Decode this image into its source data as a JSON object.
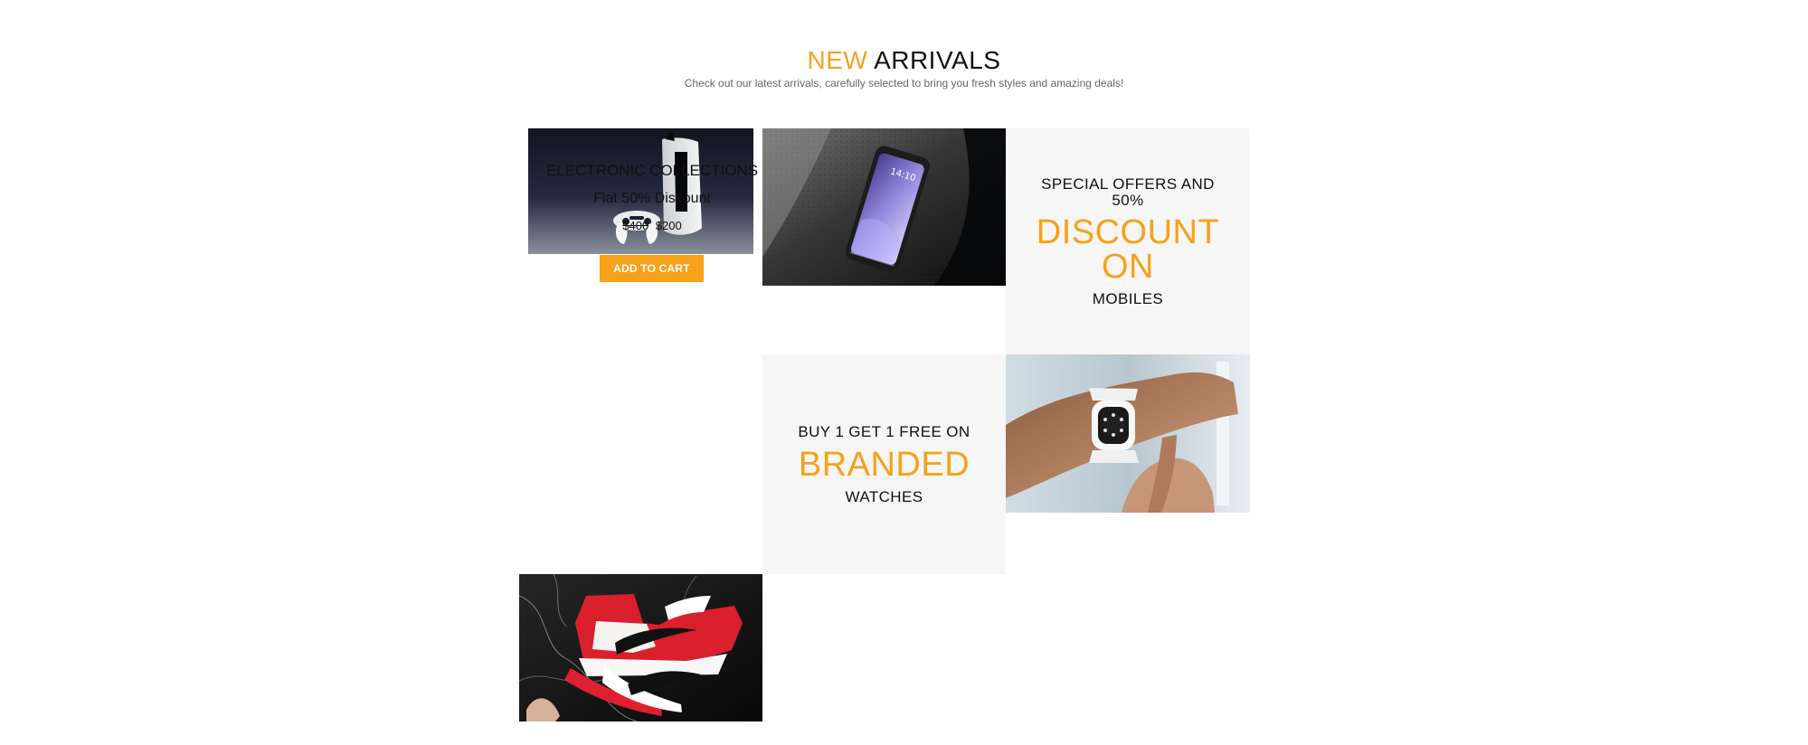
{
  "section": {
    "title_accent": "NEW",
    "title_rest": "ARRIVALS",
    "subtitle": "Check out our latest arrivals, carefully selected to bring you fresh styles and amazing deals!"
  },
  "electronic": {
    "heading": "ELECTRONIC COLLECTIONS",
    "discount": "Flat 50% Discount",
    "old_price": "$400",
    "new_price": "$200",
    "button_label": "ADD TO CART"
  },
  "promo_mobiles": {
    "line1": "SPECIAL OFFERS AND 50%",
    "highlight": "DISCOUNT ON",
    "line2": "MOBILES"
  },
  "promo_watches": {
    "line1": "BUY 1 GET 1 FREE ON",
    "highlight": "BRANDED",
    "line2": "WATCHES"
  },
  "colors": {
    "accent": "#f6a21b",
    "promo_background": "#f6f6f6",
    "text_dark": "#111111",
    "text_muted": "#666666"
  }
}
